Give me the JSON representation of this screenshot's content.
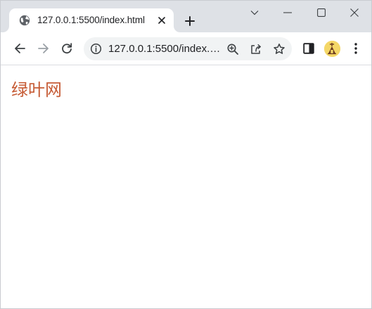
{
  "tabs": [
    {
      "title": "127.0.0.1:5500/index.html",
      "favicon": "globe-icon",
      "active": true
    }
  ],
  "window_controls": [
    "chevron-down-icon",
    "minimize-icon",
    "maximize-icon",
    "close-icon"
  ],
  "toolbar": {
    "back_icon": "back-arrow-icon",
    "forward_icon": "forward-arrow-icon",
    "reload_icon": "reload-icon"
  },
  "omnibox": {
    "url": "127.0.0.1:5500/index.html",
    "icons": [
      "info-icon",
      "zoom-icon",
      "share-icon",
      "star-icon"
    ]
  },
  "extensions": [
    "side-panel-icon",
    "profile-avatar",
    "menu-icon"
  ],
  "page": {
    "heading": "绿叶网",
    "heading_color": "#c65b35"
  },
  "colors": {
    "tabstrip": "#dee1e6",
    "omnibox": "#f1f3f4",
    "icon": "#5f6368"
  }
}
